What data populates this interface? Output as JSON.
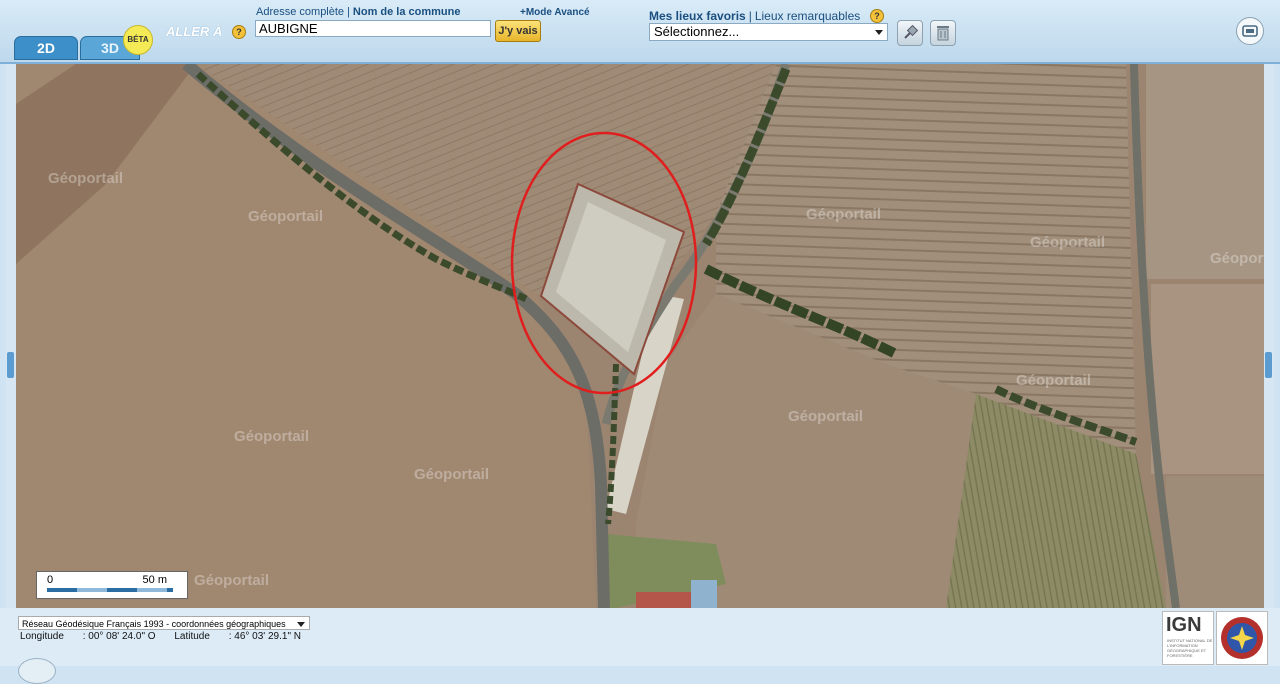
{
  "tabs": {
    "tab_2d": "2D",
    "tab_3d": "3D",
    "beta": "BÉTA"
  },
  "goto": {
    "label": "ALLER À",
    "help": "?",
    "address_link": "Adresse complète",
    "separator": "|",
    "commune_link": "Nom de la commune",
    "advanced_mode": "+Mode Avancé",
    "input_value": "AUBIGNE",
    "go_button": "J'y vais"
  },
  "favorites": {
    "my_places": "Mes lieux favoris",
    "separator": "|",
    "remarkable_places": "Lieux remarquables",
    "help": "?",
    "select_value": "Sélectionnez..."
  },
  "map": {
    "watermark": "Géoportail",
    "scale_zero": "0",
    "scale_label": "50 m",
    "highlight_color": "#e01e1e"
  },
  "footer": {
    "projection": "Réseau Géodésique Français 1993 - coordonnées géographiques",
    "longitude_label": "Longitude",
    "longitude_value": ": 00° 08' 24.0\" O",
    "latitude_label": "Latitude",
    "latitude_value": ": 46° 03' 29.1\" N",
    "ign_logo": "IGN",
    "ign_subtitle": "INSTITUT NATIONAL DE L'INFORMATION GÉOGRAPHIQUE ET FORESTIÈRE"
  }
}
